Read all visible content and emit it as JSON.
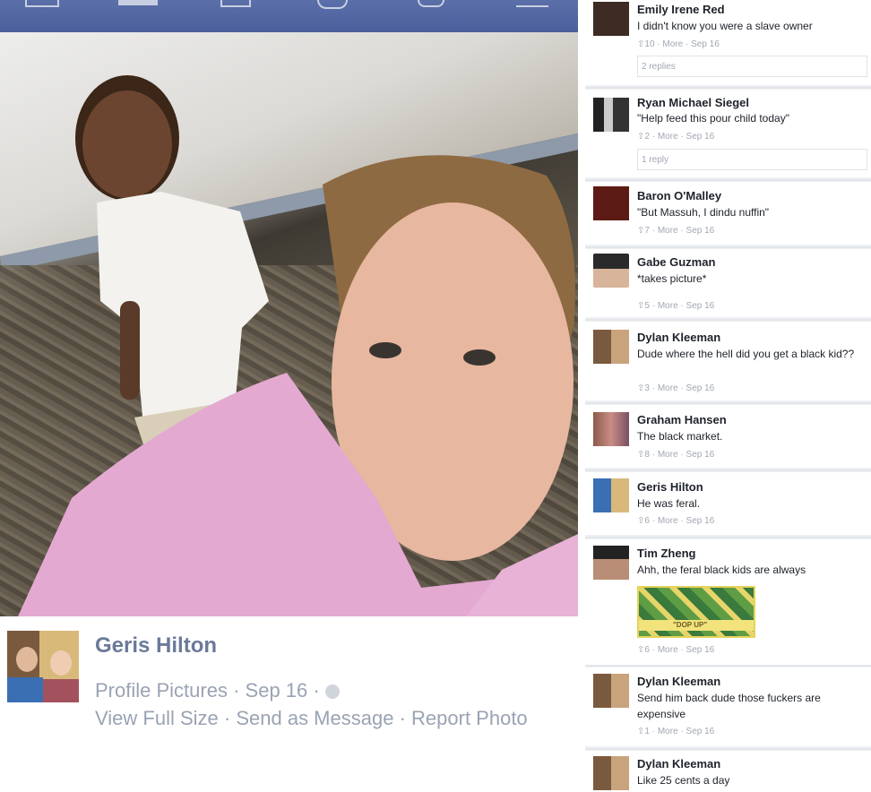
{
  "photo_caption": {
    "name": "Geris Hilton",
    "album": "Profile Pictures",
    "date": "Sep 16",
    "actions": [
      "View Full Size",
      "Send as Message",
      "Report Photo"
    ]
  },
  "comments": [
    {
      "name": "Emily Irene Red",
      "text": "I didn't know you were a slave owner",
      "likes": "10",
      "more": "More",
      "date": "Sep 16",
      "replies": "2 replies",
      "avatar": "avatar-dark-photo"
    },
    {
      "name": "Ryan Michael Siegel",
      "text": "\"Help feed this pour child today\"",
      "likes": "2",
      "more": "More",
      "date": "Sep 16",
      "replies": "1 reply",
      "avatar": "avatar-bw-photo"
    },
    {
      "name": "Baron O'Malley",
      "text": "\"But Massuh, I dindu nuffin\"",
      "likes": "7",
      "more": "More",
      "date": "Sep 16",
      "avatar": "avatar-logo"
    },
    {
      "name": "Gabe Guzman",
      "text": "*takes picture*",
      "likes": "5",
      "more": "More",
      "date": "Sep 16",
      "avatar": "avatar-person"
    },
    {
      "name": "Dylan Kleeman",
      "text": "Dude where the hell did you get a black kid??",
      "likes": "3",
      "more": "More",
      "date": "Sep 16",
      "avatar": "avatar-couple"
    },
    {
      "name": "Graham Hansen",
      "text": "The black market.",
      "likes": "8",
      "more": "More",
      "date": "Sep 16",
      "avatar": "avatar-group"
    },
    {
      "name": "Geris Hilton",
      "text": "He was feral.",
      "likes": "6",
      "more": "More",
      "date": "Sep 16",
      "avatar": "avatar-couple"
    },
    {
      "name": "Tim Zheng",
      "text": "Ahh, the feral black kids are always",
      "likes": "6",
      "more": "More",
      "date": "Sep 16",
      "avatar": "avatar-person",
      "sticker": "\"DOP UP\""
    },
    {
      "name": "Dylan Kleeman",
      "text": "Send him back dude those fuckers are expensive",
      "likes": "1",
      "more": "More",
      "date": "Sep 16",
      "avatar": "avatar-couple"
    },
    {
      "name": "Dylan Kleeman",
      "text": "Like 25 cents a day",
      "avatar": "avatar-couple"
    }
  ],
  "colors": {
    "nav": "#4a5f9b",
    "name_gray": "#6b7a99",
    "meta_gray": "#9aa3b3"
  }
}
